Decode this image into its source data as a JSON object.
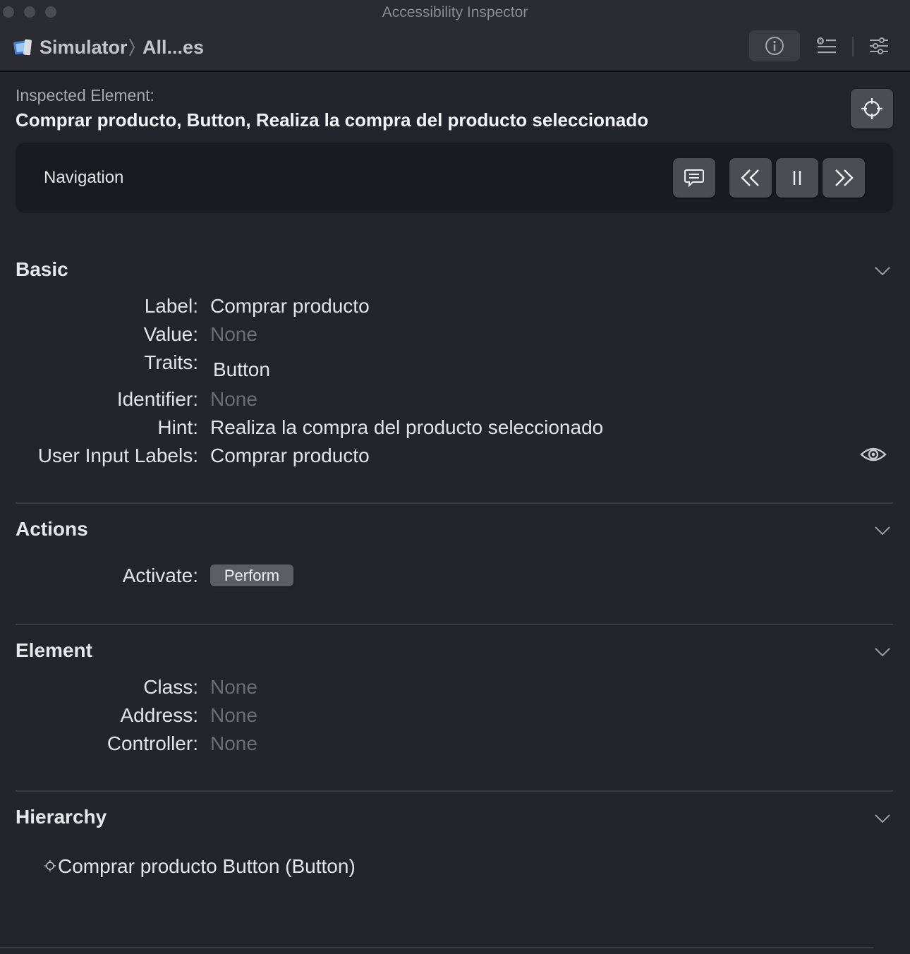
{
  "window": {
    "title": "Accessibility Inspector"
  },
  "toolbar": {
    "breadcrumb": [
      "Simulator",
      "All...es"
    ],
    "buttons": [
      {
        "name": "inspector-info",
        "icon": "info-circle-icon",
        "active": true
      },
      {
        "name": "audit",
        "icon": "audit-list-icon",
        "active": false
      },
      {
        "name": "settings",
        "icon": "sliders-icon",
        "active": false
      }
    ]
  },
  "inspected": {
    "caption": "Inspected Element:",
    "value": "Comprar producto, Button, Realiza la compra del producto seleccionado"
  },
  "navigation": {
    "label": "Navigation",
    "buttons": [
      "speech-bubble-icon",
      "previous-icon",
      "pause-icon",
      "next-icon"
    ]
  },
  "basic": {
    "title": "Basic",
    "rows": [
      {
        "key": "Label:",
        "value": "Comprar producto",
        "empty": false
      },
      {
        "key": "Value:",
        "value": "None",
        "empty": true
      },
      {
        "key": "Traits:",
        "value": "Button",
        "empty": false
      },
      {
        "key": "Identifier:",
        "value": "None",
        "empty": true
      },
      {
        "key": "Hint:",
        "value": "Realiza la compra del producto seleccionado",
        "empty": false
      },
      {
        "key": "User Input Labels:",
        "value": "Comprar producto",
        "empty": false
      }
    ]
  },
  "actions": {
    "title": "Actions",
    "activate_label": "Activate:",
    "perform_label": "Perform"
  },
  "element": {
    "title": "Element",
    "rows": [
      {
        "key": "Class:",
        "value": "None"
      },
      {
        "key": "Address:",
        "value": "None"
      },
      {
        "key": "Controller:",
        "value": "None"
      }
    ]
  },
  "hierarchy": {
    "title": "Hierarchy",
    "items": [
      "Comprar producto Button (Button)"
    ]
  },
  "colors": {
    "background": "#22252c",
    "panel": "#191b20",
    "button": "#4b4d53",
    "muted_text": "#6d6f75"
  }
}
